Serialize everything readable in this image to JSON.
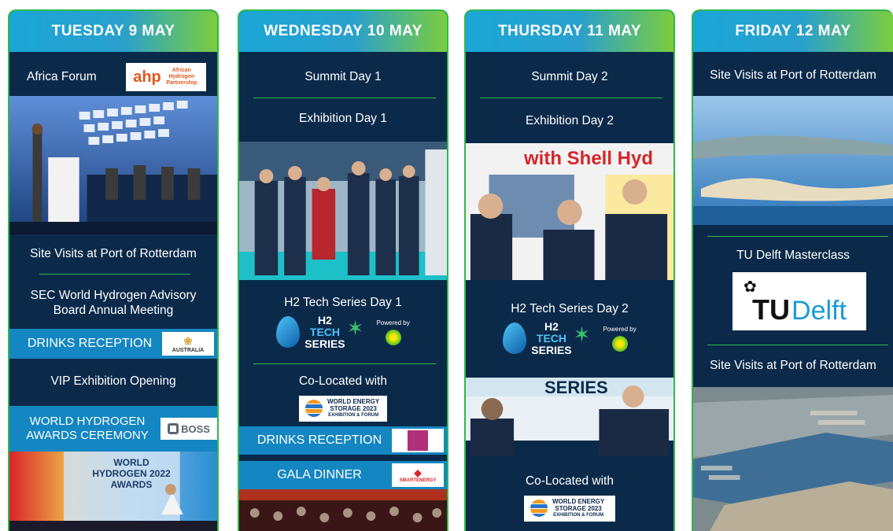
{
  "days": [
    {
      "title": "TUESDAY 9 MAY",
      "items": {
        "africa_forum": "Africa Forum",
        "africa_logo_mark": "ahp",
        "africa_logo_text": "African Hydrogen Partnership",
        "site_visits": "Site Visits at Port of Rotterdam",
        "sec_meeting": "SEC World Hydrogen Advisory Board Annual Meeting",
        "drinks": "DRINKS RECEPTION",
        "drinks_logo": "AUSTRALIA",
        "vip": "VIP Exhibition Opening",
        "awards": "WORLD HYDROGEN AWARDS CEREMONY",
        "awards_logo": "BOSS",
        "awards_photo_text": "WORLD HYDROGEN 2022 AWARDS"
      }
    },
    {
      "title": "WEDNESDAY 10 MAY",
      "items": {
        "summit": "Summit Day 1",
        "exhibition": "Exhibition Day 1",
        "h2_tech": "H2 Tech Series Day 1",
        "colocated": "Co-Located with",
        "drinks": "DRINKS RECEPTION",
        "gala": "GALA DINNER",
        "gala_logo": "SMARTENERGY"
      }
    },
    {
      "title": "THURSDAY 11 MAY",
      "items": {
        "summit": "Summit Day 2",
        "exhibition": "Exhibition Day 2",
        "photo_text": "with Shell Hyd",
        "h2_tech": "H2 Tech Series Day 2",
        "series_photo_text": "SERIES",
        "colocated": "Co-Located with"
      }
    },
    {
      "title": "FRIDAY 12 MAY",
      "items": {
        "site_visits_1": "Site Visits at Port of Rotterdam",
        "masterclass": "TU Delft Masterclass",
        "tudelft_tu": "TU",
        "tudelft_delft": "Delft",
        "site_visits_2": "Site Visits at Port of Rotterdam"
      }
    }
  ],
  "shared": {
    "h2_l1": "H2",
    "h2_l2": "TECH",
    "h2_l3": "SERIES",
    "powered_by": "Powered by",
    "bp": "bp",
    "wes_l1": "WORLD ENERGY",
    "wes_l2": "STORAGE 2023",
    "wes_l3": "EXHIBITION & FORUM"
  },
  "colors": {
    "panel": "#0b2a4a",
    "band": "#1486c2",
    "accent_green": "#2fb84a",
    "header_from": "#1aa6d6",
    "header_to": "#7ccd3d"
  }
}
